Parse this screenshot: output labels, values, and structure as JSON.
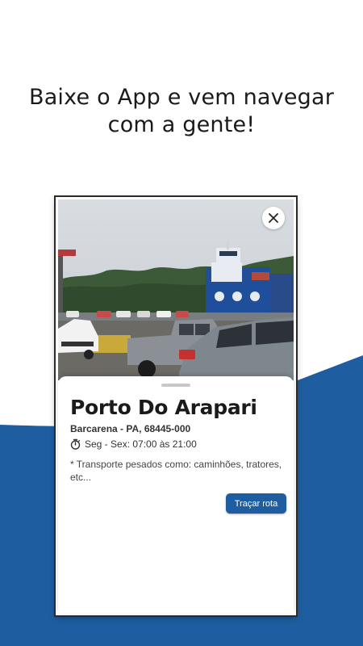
{
  "promo": {
    "headline_line1": "Baixe o App e vem navegar",
    "headline_line2": "com a gente!"
  },
  "colors": {
    "accent_blue": "#1e5ea0",
    "background": "#ffffff"
  },
  "photo": {
    "description_icon": "ferry-port-photo"
  },
  "close_icon": "close-icon",
  "place": {
    "title": "Porto Do Arapari",
    "address": "Barcarena - PA, 68445-000",
    "hours": "Seg - Sex: 07:00 às 21:00",
    "note_line1": "* Transporte pesados como: caminhões, tratores,",
    "note_line2": "etc...",
    "route_button": "Traçar rota",
    "hours_icon": "stopwatch-icon"
  }
}
